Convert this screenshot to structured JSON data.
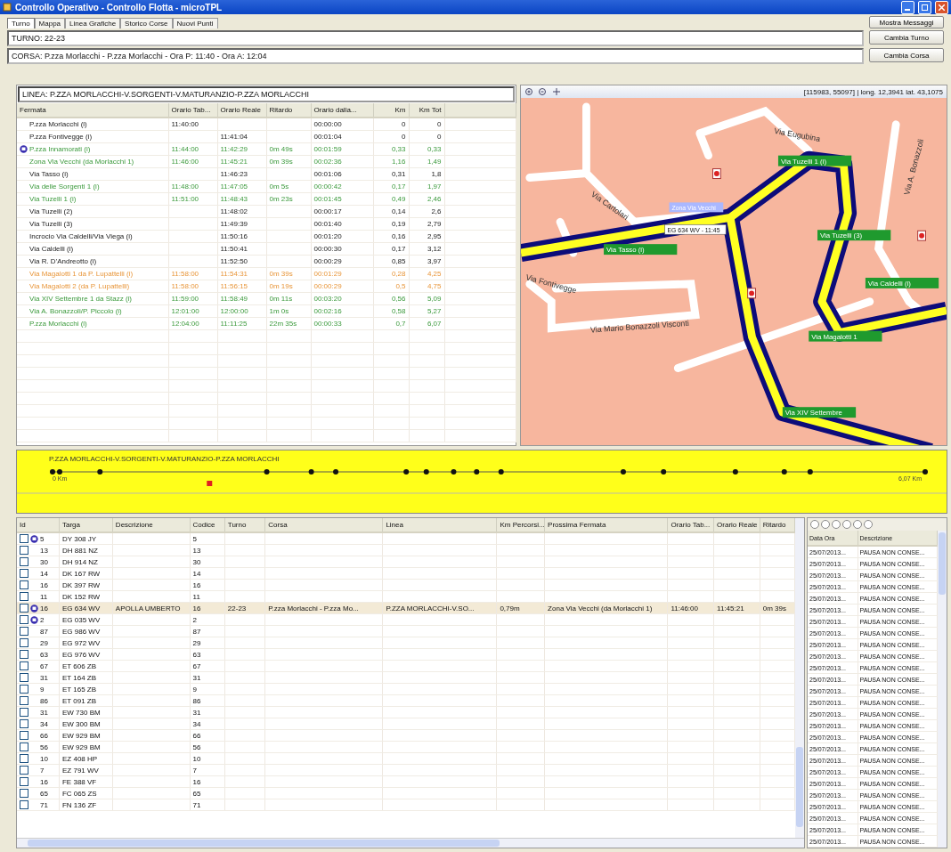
{
  "window": {
    "title": "Controllo Operativo - Controllo Flotta - microTPL"
  },
  "tabs": [
    {
      "label": "Turno",
      "selected": true
    },
    {
      "label": "Mappa",
      "selected": false
    },
    {
      "label": "Linea Grafiche",
      "selected": false
    },
    {
      "label": "Storico Corse",
      "selected": false
    },
    {
      "label": "Nuovi Punti",
      "selected": false
    }
  ],
  "top_button": "Mostra Messaggi",
  "turno": {
    "text": "TURNO: 22-23",
    "button": "Cambia Turno"
  },
  "corsa": {
    "text": "CORSA: P.zza Morlacchi - P.zza Morlacchi - Ora P: 11:40 - Ora A: 12:04",
    "button": "Cambia Corsa"
  },
  "linea": "LINEA: P.ZZA MORLACCHI-V.SORGENTI-V.MATURANZIO-P.ZZA MORLACCHI",
  "stops": {
    "columns": [
      "Fermata",
      "Orario Tab...",
      "Orario Reale",
      "Ritardo",
      "Orario dalla...",
      "Km",
      "Km Tot"
    ],
    "rows": [
      {
        "early": false,
        "late": false,
        "vehicle": false,
        "cells": [
          "P.zza Morlacchi (i)",
          "11:40:00",
          "",
          "",
          "00:00:00",
          "0",
          "0"
        ]
      },
      {
        "early": false,
        "late": false,
        "vehicle": false,
        "cells": [
          "P.zza Fontivegge (i)",
          "",
          "11:41:04",
          "",
          "00:01:04",
          "0",
          "0"
        ]
      },
      {
        "early": true,
        "late": false,
        "vehicle": true,
        "cells": [
          "P.zza Innamorati (i)",
          "11:44:00",
          "11:42:29",
          "0m 49s",
          "00:01:59",
          "0,33",
          "0,33"
        ]
      },
      {
        "early": true,
        "late": false,
        "vehicle": false,
        "cells": [
          "Zona Via Vecchi (da Morlacchi 1)",
          "11:46:00",
          "11:45:21",
          "0m 39s",
          "00:02:36",
          "1,16",
          "1,49"
        ]
      },
      {
        "early": false,
        "late": false,
        "vehicle": false,
        "cells": [
          "Via Tasso (i)",
          "",
          "11:46:23",
          "",
          "00:01:06",
          "0,31",
          "1,8"
        ]
      },
      {
        "early": true,
        "late": false,
        "vehicle": false,
        "cells": [
          "Via delle Sorgenti 1 (i)",
          "11:48:00",
          "11:47:05",
          "0m 5s",
          "00:00:42",
          "0,17",
          "1,97"
        ]
      },
      {
        "early": true,
        "late": false,
        "vehicle": false,
        "cells": [
          "Via Tuzelli 1 (i)",
          "11:51:00",
          "11:48:43",
          "0m 23s",
          "00:01:45",
          "0,49",
          "2,46"
        ]
      },
      {
        "early": false,
        "late": false,
        "vehicle": false,
        "cells": [
          "Via Tuzelli (2)",
          "",
          "11:48:02",
          "",
          "00:00:17",
          "0,14",
          "2,6"
        ]
      },
      {
        "early": false,
        "late": false,
        "vehicle": false,
        "cells": [
          "Via Tuzelli (3)",
          "",
          "11:49:39",
          "",
          "00:01:40",
          "0,19",
          "2,79"
        ]
      },
      {
        "early": false,
        "late": false,
        "vehicle": false,
        "cells": [
          "Incrocio Via Caldelli/Via Viega (i)",
          "",
          "11:50:16",
          "",
          "00:01:20",
          "0,16",
          "2,95"
        ]
      },
      {
        "early": false,
        "late": false,
        "vehicle": false,
        "cells": [
          "Via Caldelli (i)",
          "",
          "11:50:41",
          "",
          "00:00:30",
          "0,17",
          "3,12"
        ]
      },
      {
        "early": false,
        "late": false,
        "vehicle": false,
        "cells": [
          "Via R. D'Andreotto (i)",
          "",
          "11:52:50",
          "",
          "00:00:29",
          "0,85",
          "3,97"
        ]
      },
      {
        "early": false,
        "late": true,
        "vehicle": false,
        "cells": [
          "Via Magalotti 1 da P. Lupattelli (i)",
          "11:58:00",
          "11:54:31",
          "0m 39s",
          "00:01:29",
          "0,28",
          "4,25"
        ]
      },
      {
        "early": false,
        "late": true,
        "vehicle": false,
        "cells": [
          "Via Magalotti 2 (da P. Lupattelli)",
          "11:58:00",
          "11:56:15",
          "0m 19s",
          "00:00:29",
          "0,5",
          "4,75"
        ]
      },
      {
        "early": true,
        "late": false,
        "vehicle": false,
        "cells": [
          "Via XIV Settembre 1 da Stazz (i)",
          "11:59:00",
          "11:58:49",
          "0m 11s",
          "00:03:20",
          "0,56",
          "5,09"
        ]
      },
      {
        "early": true,
        "late": false,
        "vehicle": false,
        "cells": [
          "Via A. Bonazzoli/P. Piccolo (i)",
          "12:01:00",
          "12:00:00",
          "1m 0s",
          "00:02:16",
          "0,58",
          "5,27"
        ]
      },
      {
        "early": true,
        "late": false,
        "vehicle": false,
        "cells": [
          "P.zza Morlacchi (i)",
          "12:04:00",
          "11:11:25",
          "22m 35s",
          "00:00:33",
          "0,7",
          "6,07"
        ]
      }
    ]
  },
  "map": {
    "coords": "[115983, 55097]  |  long. 12,3941  lat. 43,1075",
    "stop_labels": [
      "Via Tuzelli 1 (i)",
      "Via Tuzelli (3)",
      "Via Caldelli (i)",
      "Via Tasso (i)",
      "Via Magalotti 1",
      "Via XIV Settembre"
    ],
    "vehicle_label": "EG 634 WV - 11:45",
    "blue_label": "Zona Via Vecchi",
    "street_labels": [
      "Via Eugubina",
      "Via A. Bonazzoli",
      "Via Mario Bonazzoli Visconti",
      "Via Cartolari",
      "Via Fontivegge"
    ]
  },
  "strip": {
    "title": "P.ZZA MORLACCHI-V.SORGENTI-V.MATURANZIO-P.ZZA MORLACCHI",
    "start": "0 Km",
    "end": "6,07 Km"
  },
  "vehicles": {
    "columns": [
      "Id",
      "Targa",
      "Descrizione",
      "Codice",
      "Turno",
      "Corsa",
      "Linea",
      "Km Percorsi...",
      "Prossima Fermata",
      "Orario Tab...",
      "Orario Reale",
      "Ritardo"
    ],
    "rows": [
      {
        "checked": false,
        "flag": true,
        "selected": false,
        "cells": [
          "5",
          "DY 308 JY",
          "",
          "5"
        ]
      },
      {
        "checked": false,
        "flag": false,
        "selected": false,
        "cells": [
          "13",
          "DH 881 NZ",
          "",
          "13"
        ]
      },
      {
        "checked": false,
        "flag": false,
        "selected": false,
        "cells": [
          "30",
          "DH 914 NZ",
          "",
          "30"
        ]
      },
      {
        "checked": false,
        "flag": false,
        "selected": false,
        "cells": [
          "14",
          "DK 167 RW",
          "",
          "14"
        ]
      },
      {
        "checked": false,
        "flag": false,
        "selected": false,
        "cells": [
          "16",
          "DK 397 RW",
          "",
          "16"
        ]
      },
      {
        "checked": false,
        "flag": false,
        "selected": false,
        "cells": [
          "11",
          "DK 152 RW",
          "",
          "11"
        ]
      },
      {
        "checked": false,
        "flag": true,
        "selected": true,
        "cells": [
          "16",
          "EG 634 WV",
          "APOLLA UMBERTO",
          "16",
          "22-23",
          "P.zza Morlacchi - P.zza Mo...",
          "P.ZZA MORLACCHI-V.SO...",
          "0,79m",
          "Zona Via Vecchi (da Morlacchi 1)",
          "11:46:00",
          "11:45:21",
          "0m 39s"
        ]
      },
      {
        "checked": false,
        "flag": true,
        "selected": false,
        "cells": [
          "2",
          "EG 035 WV",
          "",
          "2"
        ]
      },
      {
        "checked": false,
        "flag": false,
        "selected": false,
        "cells": [
          "87",
          "EG 986 WV",
          "",
          "87"
        ]
      },
      {
        "checked": false,
        "flag": false,
        "selected": false,
        "cells": [
          "29",
          "EG 972 WV",
          "",
          "29"
        ]
      },
      {
        "checked": false,
        "flag": false,
        "selected": false,
        "cells": [
          "63",
          "EG 976 WV",
          "",
          "63"
        ]
      },
      {
        "checked": false,
        "flag": false,
        "selected": false,
        "cells": [
          "67",
          "ET 606 ZB",
          "",
          "67"
        ]
      },
      {
        "checked": false,
        "flag": false,
        "selected": false,
        "cells": [
          "31",
          "ET 164 ZB",
          "",
          "31"
        ]
      },
      {
        "checked": false,
        "flag": false,
        "selected": false,
        "cells": [
          "9",
          "ET 165 ZB",
          "",
          "9"
        ]
      },
      {
        "checked": false,
        "flag": false,
        "selected": false,
        "cells": [
          "86",
          "ET 091 ZB",
          "",
          "86"
        ]
      },
      {
        "checked": false,
        "flag": false,
        "selected": false,
        "cells": [
          "31",
          "EW 730 BM",
          "",
          "31"
        ]
      },
      {
        "checked": false,
        "flag": false,
        "selected": false,
        "cells": [
          "34",
          "EW 300 BM",
          "",
          "34"
        ]
      },
      {
        "checked": false,
        "flag": false,
        "selected": false,
        "cells": [
          "66",
          "EW 929 BM",
          "",
          "66"
        ]
      },
      {
        "checked": false,
        "flag": false,
        "selected": false,
        "cells": [
          "56",
          "EW 929 BM",
          "",
          "56"
        ]
      },
      {
        "checked": false,
        "flag": false,
        "selected": false,
        "cells": [
          "10",
          "EZ 408 HP",
          "",
          "10"
        ]
      },
      {
        "checked": false,
        "flag": false,
        "selected": false,
        "cells": [
          "7",
          "EZ 791 WV",
          "",
          "7"
        ]
      },
      {
        "checked": false,
        "flag": false,
        "selected": false,
        "cells": [
          "16",
          "FE 388 VF",
          "",
          "16"
        ]
      },
      {
        "checked": false,
        "flag": false,
        "selected": false,
        "cells": [
          "65",
          "FC 065 ZS",
          "",
          "65"
        ]
      },
      {
        "checked": false,
        "flag": false,
        "selected": false,
        "cells": [
          "71",
          "FN 136 ZF",
          "",
          "71"
        ]
      }
    ]
  },
  "messages": {
    "columns": [
      "Data Ora",
      "Descrizione"
    ],
    "rows": [
      [
        "25/07/2013...",
        "PAUSA NON CONSE..."
      ],
      [
        "25/07/2013...",
        "PAUSA NON CONSE..."
      ],
      [
        "25/07/2013...",
        "PAUSA NON CONSE..."
      ],
      [
        "25/07/2013...",
        "PAUSA NON CONSE..."
      ],
      [
        "25/07/2013...",
        "PAUSA NON CONSE..."
      ],
      [
        "25/07/2013...",
        "PAUSA NON CONSE..."
      ],
      [
        "25/07/2013...",
        "PAUSA NON CONSE..."
      ],
      [
        "25/07/2013...",
        "PAUSA NON CONSE..."
      ],
      [
        "25/07/2013...",
        "PAUSA NON CONSE..."
      ],
      [
        "25/07/2013...",
        "PAUSA NON CONSE..."
      ],
      [
        "25/07/2013...",
        "PAUSA NON CONSE..."
      ],
      [
        "25/07/2013...",
        "PAUSA NON CONSE..."
      ],
      [
        "25/07/2013...",
        "PAUSA NON CONSE..."
      ],
      [
        "25/07/2013...",
        "PAUSA NON CONSE..."
      ],
      [
        "25/07/2013...",
        "PAUSA NON CONSE..."
      ],
      [
        "25/07/2013...",
        "PAUSA NON CONSE..."
      ],
      [
        "25/07/2013...",
        "PAUSA NON CONSE..."
      ],
      [
        "25/07/2013...",
        "PAUSA NON CONSE..."
      ],
      [
        "25/07/2013...",
        "PAUSA NON CONSE..."
      ],
      [
        "25/07/2013...",
        "PAUSA NON CONSE..."
      ],
      [
        "25/07/2013...",
        "PAUSA NON CONSE..."
      ],
      [
        "25/07/2013...",
        "PAUSA NON CONSE..."
      ],
      [
        "25/07/2013...",
        "PAUSA NON CONSE..."
      ],
      [
        "25/07/2013...",
        "PAUSA NON CONSE..."
      ],
      [
        "25/07/2013...",
        "PAUSA NON CONSE..."
      ],
      [
        "25/07/2013...",
        "PAUSA NON CONSE..."
      ]
    ]
  }
}
